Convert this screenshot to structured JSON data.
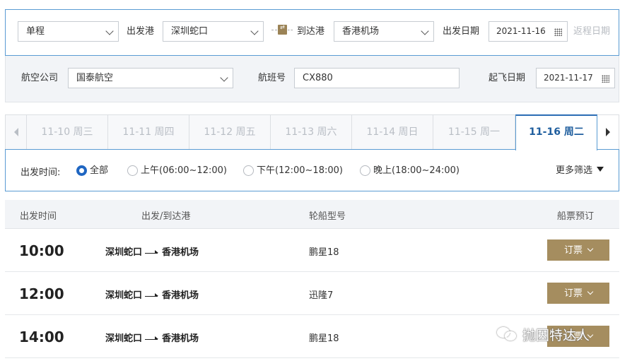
{
  "search": {
    "trip_type": "单程",
    "depart_port_label": "出发港",
    "depart_port": "深圳蛇口",
    "arrive_port_label": "到达港",
    "arrive_port": "香港机场",
    "depart_date_label": "出发日期",
    "depart_date": "2021-11-16",
    "return_date_label": "返程日期"
  },
  "flight": {
    "airline_label": "航空公司",
    "airline": "国泰航空",
    "flight_no_label": "航班号",
    "flight_no": "CX880",
    "takeoff_date_label": "起飞日期",
    "takeoff_date": "2021-11-17"
  },
  "date_tabs": [
    {
      "label": "11-10 周三",
      "active": false
    },
    {
      "label": "11-11 周四",
      "active": false
    },
    {
      "label": "11-12 周五",
      "active": false
    },
    {
      "label": "11-13 周六",
      "active": false
    },
    {
      "label": "11-14 周日",
      "active": false
    },
    {
      "label": "11-15 周一",
      "active": false
    },
    {
      "label": "11-16 周二",
      "active": true
    }
  ],
  "filter": {
    "label": "出发时间:",
    "options": [
      {
        "label": "全部",
        "selected": true
      },
      {
        "label": "上午(06:00~12:00)",
        "selected": false
      },
      {
        "label": "下午(12:00~18:00)",
        "selected": false
      },
      {
        "label": "晚上(18:00~24:00)",
        "selected": false
      }
    ],
    "more": "更多筛选"
  },
  "table": {
    "headers": [
      "出发时间",
      "出发/到达港",
      "轮船型号",
      "船票预订"
    ],
    "rows": [
      {
        "time": "10:00",
        "from": "深圳蛇口",
        "to": "香港机场",
        "vessel": "鹏星18",
        "action": "订票"
      },
      {
        "time": "12:00",
        "from": "深圳蛇口",
        "to": "香港机场",
        "vessel": "迅隆7",
        "action": "订票"
      },
      {
        "time": "14:00",
        "from": "深圳蛇口",
        "to": "香港机场",
        "vessel": "鹏星18",
        "action": "订票"
      }
    ]
  },
  "watermark": "抛因特达人",
  "colors": {
    "accent_blue": "#1f66c2",
    "border_blue": "#5a9bd3",
    "gold": "#a58d5f",
    "swap_gold": "#9b8356"
  }
}
